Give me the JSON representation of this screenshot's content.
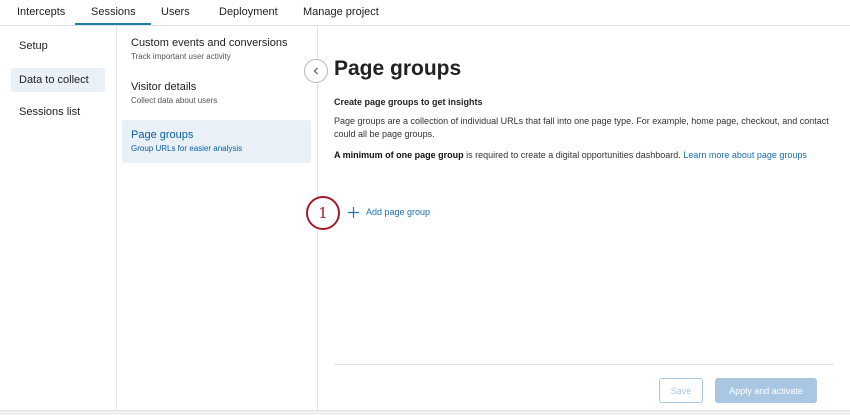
{
  "top_tabs": [
    "Intercepts",
    "Sessions",
    "Users",
    "Deployment",
    "Manage project"
  ],
  "left_nav": [
    "Setup",
    "Data to collect",
    "Sessions list"
  ],
  "middle_nav": [
    {
      "title": "Custom events and conversions",
      "subtitle": "Track important user activity"
    },
    {
      "title": "Visitor details",
      "subtitle": "Collect data about users"
    },
    {
      "title": "Page groups",
      "subtitle": "Group URLs for easier analysis"
    }
  ],
  "main": {
    "title": "Page groups",
    "subheading": "Create page groups to get insights",
    "paragraph1": "Page groups are a collection of individual URLs that fall into one page type. For example, home page, checkout, and contact could all be page groups.",
    "paragraph2_bold": "A minimum of one page group",
    "paragraph2_rest": " is required to create a digital opportunities dashboard. ",
    "paragraph2_link": "Learn more about page groups",
    "step_number": "1",
    "add_label": "Add page group"
  },
  "footer": {
    "save_label": "Save",
    "apply_label": "Apply and activate"
  },
  "colors": {
    "accent": "#1a6fb5",
    "step": "#a21d2c",
    "active_bg": "#e9f0f7",
    "disabled": "#a9c7e3"
  },
  "icons": {
    "collapse": "chevron-left-icon",
    "add": "plus-icon"
  }
}
